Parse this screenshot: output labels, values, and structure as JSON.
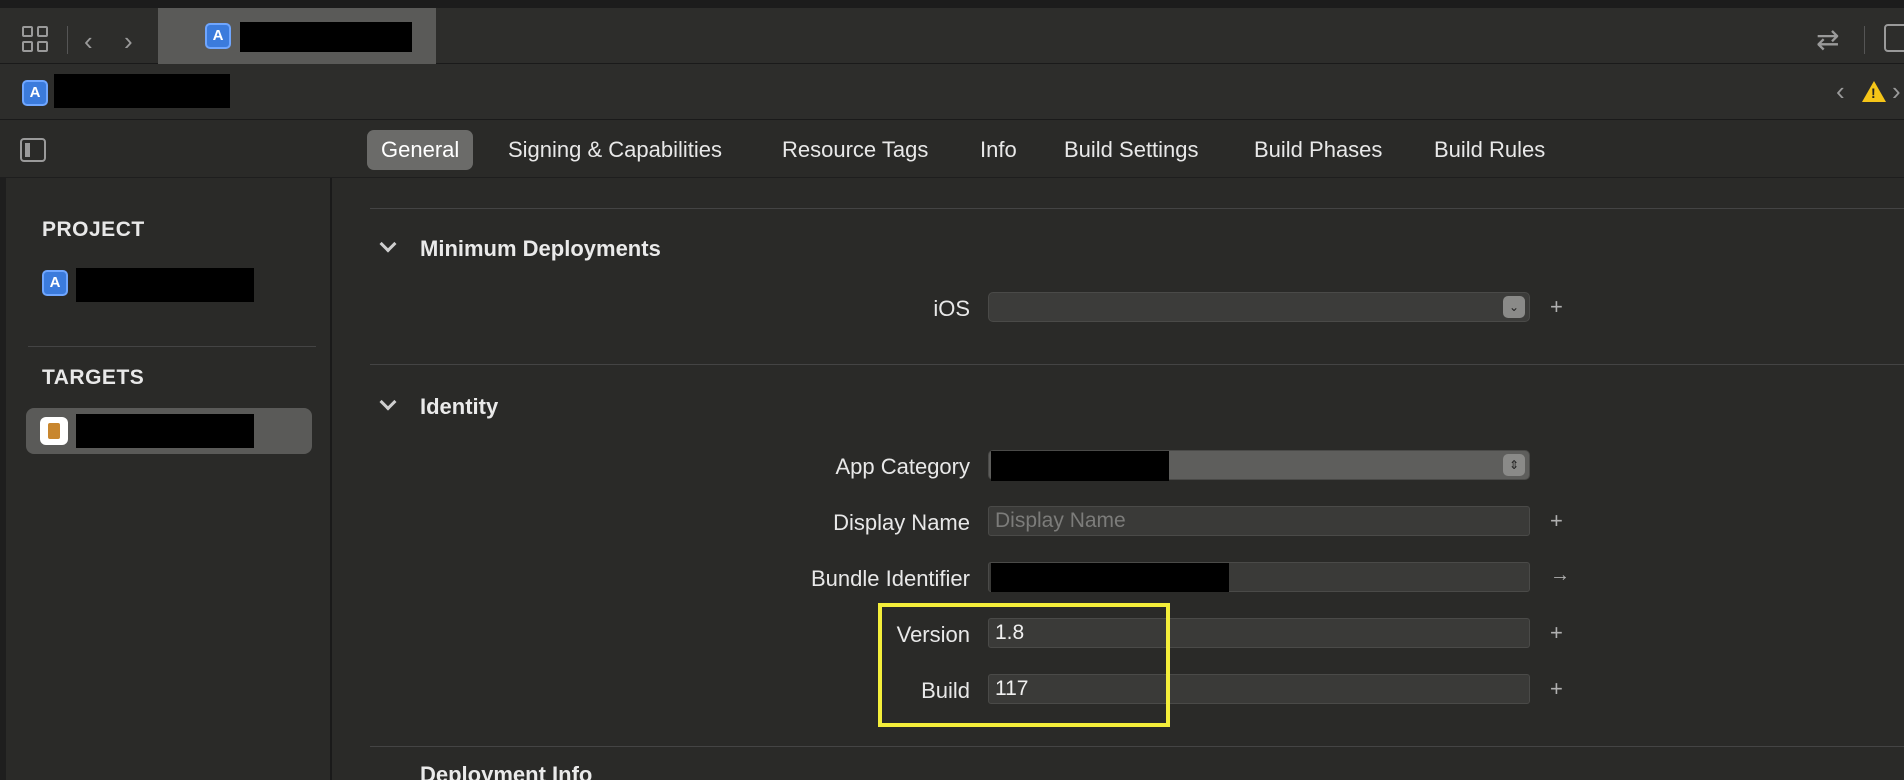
{
  "toolbar": {
    "back_icon": "chevron-left-icon",
    "forward_icon": "chevron-right-icon"
  },
  "editor_tabs": [
    {
      "label": "General",
      "active": true
    },
    {
      "label": "Signing & Capabilities"
    },
    {
      "label": "Resource Tags"
    },
    {
      "label": "Info"
    },
    {
      "label": "Build Settings"
    },
    {
      "label": "Build Phases"
    },
    {
      "label": "Build Rules"
    }
  ],
  "navigator": {
    "project_heading": "PROJECT",
    "targets_heading": "TARGETS"
  },
  "sections": {
    "min_deployments": {
      "title": "Minimum Deployments",
      "ios_label": "iOS",
      "ios_value": ""
    },
    "identity": {
      "title": "Identity",
      "app_category_label": "App Category",
      "display_name_label": "Display Name",
      "display_name_placeholder": "Display Name",
      "bundle_identifier_label": "Bundle Identifier",
      "version_label": "Version",
      "version_value": "1.8",
      "build_label": "Build",
      "build_value": "117"
    },
    "next_title": "Deployment Info"
  },
  "colors": {
    "highlight": "#f4ee3a",
    "accent": "#3b7bdc",
    "warning": "#f5c518"
  }
}
